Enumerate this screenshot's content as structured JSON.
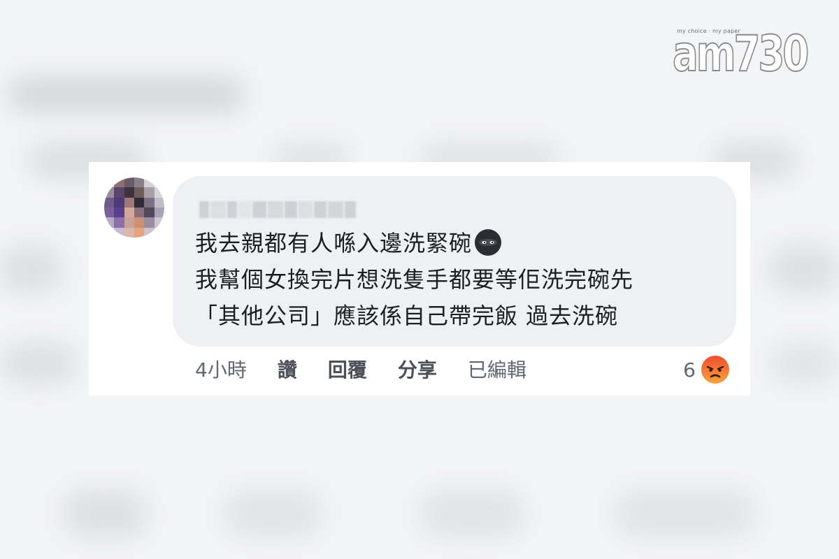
{
  "logo": {
    "tagline": "my choice · my paper",
    "text": "am730"
  },
  "comment": {
    "lines": [
      "我去親都有人喺入邊洗緊碗",
      "我幫個女換完片想洗隻手都要等佢洗完碗先",
      "「其他公司」應該係自己帶完飯 過去洗碗"
    ],
    "line1_emoji": "ninja-emoji-icon"
  },
  "actions": {
    "time": "4小時",
    "like": "讚",
    "reply": "回覆",
    "share": "分享",
    "edited": "已編輯"
  },
  "reactions": {
    "count": "6",
    "type": "angry-reaction-icon"
  },
  "colors": {
    "bubble": "#eff0f3",
    "text": "#1c1e21",
    "meta": "#606770",
    "angry": "#f0583a"
  }
}
